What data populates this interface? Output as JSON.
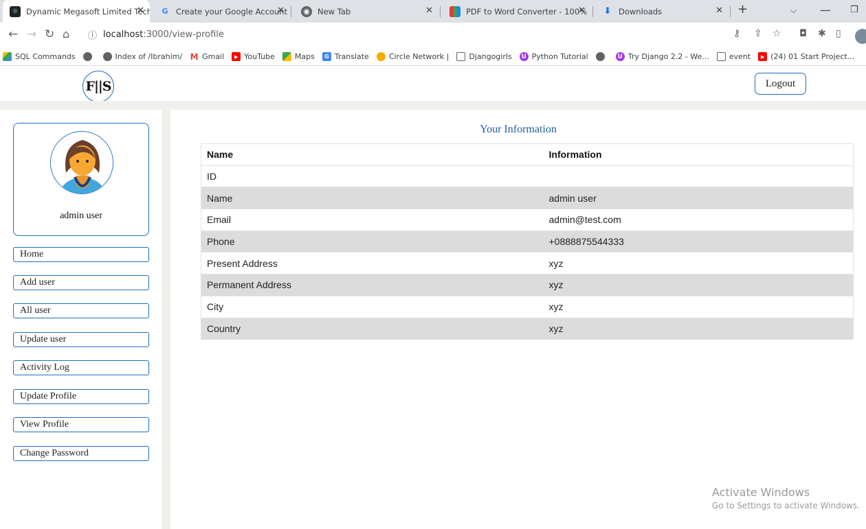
{
  "browser": {
    "tabs": [
      {
        "title": "Dynamic Megasoft Limited Tech",
        "active": true
      },
      {
        "title": "Create your Google Account",
        "active": false
      },
      {
        "title": "New Tab",
        "active": false
      },
      {
        "title": "PDF to Word Converter - 100%",
        "active": false
      },
      {
        "title": "Downloads",
        "active": false
      }
    ],
    "url_host": "localhost",
    "url_path": ":3000/view-profile",
    "bookmarks": [
      "SQL Commands",
      "",
      "Index of /Ibrahim/",
      "Gmail",
      "YouTube",
      "Maps",
      "Translate",
      "Circle Network |",
      "Djangogirls",
      "Python Tutorial",
      "",
      "Try Django 2.2 - We...",
      "event",
      "(24) 01 Start Project..."
    ]
  },
  "header": {
    "logo_text": "F||S",
    "logout_label": "Logout"
  },
  "sidebar": {
    "profile_name": "admin user",
    "menu": [
      "Home",
      "Add user",
      "All user",
      "Update user",
      "Activity Log",
      "Update Profile",
      "View Profile",
      "Change Password"
    ]
  },
  "main": {
    "title": "Your Information",
    "table": {
      "headers": [
        "Name",
        "Information"
      ],
      "rows": [
        [
          "ID",
          ""
        ],
        [
          "Name",
          "admin user"
        ],
        [
          "Email",
          "admin@test.com"
        ],
        [
          "Phone",
          "+0888875544333"
        ],
        [
          "Present Address",
          "xyz"
        ],
        [
          "Permanent Address",
          "xyz"
        ],
        [
          "City",
          "xyz"
        ],
        [
          "Country",
          "xyz"
        ]
      ]
    }
  },
  "watermark": {
    "line1": "Activate Windows",
    "line2": "Go to Settings to activate Windows."
  },
  "colors": {
    "accent": "#1e6fc0",
    "row_alt": "#dcdcdc",
    "divider": "#f0f0ed"
  }
}
